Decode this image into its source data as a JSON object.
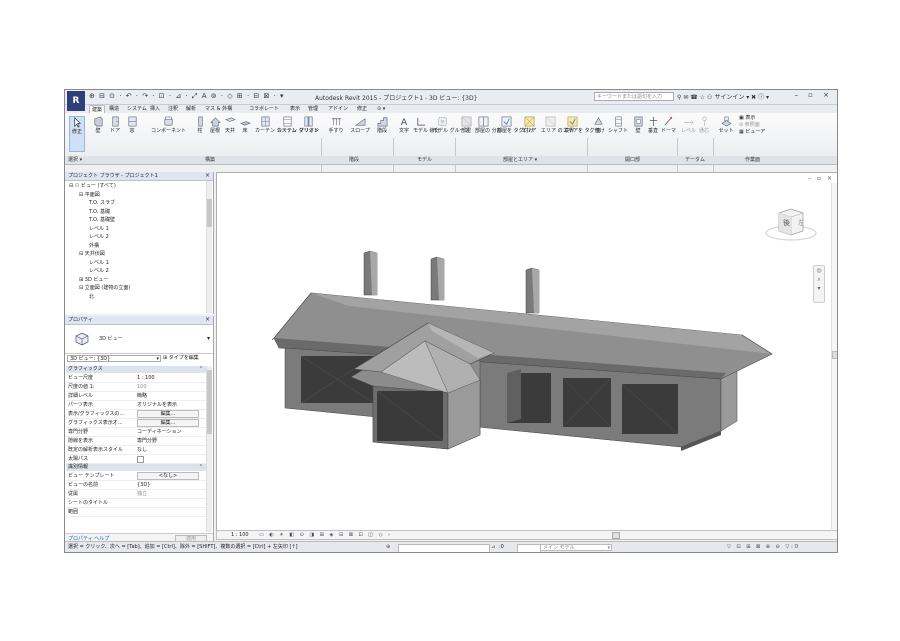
{
  "titlebar": {
    "app_button": "R",
    "quick_access": "⊕ ⊟ ⊙ · ↶ · ↷ · ⊡ · ⊿ · ⤢ A ⊚ · ◇ ⊞ · ⊟ ⊠ · ▾",
    "title": "Autodesk Revit 2015 -    プロジェクト1 - 3D ビュー: {3D}",
    "search_placeholder": "キーワードまたは語句を入力",
    "sign_in": "サインイン",
    "window_controls": "– ▫ ×"
  },
  "tabs": [
    "建築",
    "構造",
    "システム",
    "挿入",
    "注釈",
    "解析",
    "マス & 外構",
    "コラボレート",
    "表示",
    "管理",
    "アドイン",
    "修正",
    "⊙ ▾"
  ],
  "active_tab": "建築",
  "ribbon": {
    "buttons": [
      {
        "label": "修正"
      },
      {
        "label": "壁"
      },
      {
        "label": "ドア"
      },
      {
        "label": "窓"
      },
      {
        "label": "コンポーネント"
      },
      {
        "label": "柱"
      },
      {
        "label": "屋根"
      },
      {
        "label": "天井"
      },
      {
        "label": "床"
      },
      {
        "label": "カーテン システム"
      },
      {
        "label": "カーテン グリッド"
      },
      {
        "label": "マリオン"
      },
      {
        "label": "手すり"
      },
      {
        "label": "スロープ"
      },
      {
        "label": "階段"
      },
      {
        "label": "文字"
      },
      {
        "label": "モデル 線分"
      },
      {
        "label": "モデル グループ"
      },
      {
        "label": "部屋"
      },
      {
        "label": "部屋の 分割"
      },
      {
        "label": "部屋を タグ付け"
      },
      {
        "label": "エリア"
      },
      {
        "label": "エリア の 境界"
      },
      {
        "label": "エリアを タグ付け"
      },
      {
        "label": "面"
      },
      {
        "label": "シャフト"
      },
      {
        "label": "壁"
      },
      {
        "label": "垂直"
      },
      {
        "label": "ドーマ"
      },
      {
        "label": "レベル"
      },
      {
        "label": "通芯"
      },
      {
        "label": "セット"
      },
      {
        "label": "表示"
      },
      {
        "label": "参照面"
      },
      {
        "label": "ビューア"
      }
    ],
    "panels": [
      "選択 ▾",
      "構築",
      "階段",
      "モデル",
      "部屋とエリア ▾",
      "開口部",
      "データム",
      "作業面"
    ]
  },
  "browser": {
    "title": "プロジェクト ブラウザ - プロジェクト1",
    "items": [
      {
        "label": "ビュー (すべて)",
        "prefix": "⊟"
      },
      {
        "label": "平面図",
        "prefix": "⊟"
      },
      {
        "label": "T.O. スラブ",
        "prefix": ""
      },
      {
        "label": "T.O. 基礎",
        "prefix": ""
      },
      {
        "label": "T.O. 基礎壁",
        "prefix": ""
      },
      {
        "label": "レベル 1",
        "prefix": ""
      },
      {
        "label": "レベル 2",
        "prefix": ""
      },
      {
        "label": "外構",
        "prefix": ""
      },
      {
        "label": "天井伏図",
        "prefix": "⊟"
      },
      {
        "label": "レベル 1",
        "prefix": ""
      },
      {
        "label": "レベル 2",
        "prefix": ""
      },
      {
        "label": "3D ビュー",
        "prefix": "⊞"
      },
      {
        "label": "立面図 (建物の立面)",
        "prefix": "⊟"
      },
      {
        "label": "北",
        "prefix": ""
      }
    ]
  },
  "properties": {
    "title": "プロパティ",
    "type_name": "3D ビュー",
    "type_selector": "3D ビュー: {3D}",
    "edit_type": "タイプを編集",
    "section_graphics": "グラフィックス",
    "section_identity": "識別情報",
    "rows": [
      {
        "k": "ビュー尺度",
        "v": "1 : 100"
      },
      {
        "k": "尺度の値   1:",
        "v": "100"
      },
      {
        "k": "詳細レベル",
        "v": "簡略"
      },
      {
        "k": "パーツ表示",
        "v": "オリジナルを表示"
      },
      {
        "k": "表示/グラフィックスの...",
        "v": "編集..."
      },
      {
        "k": "グラフィックス表示オ...",
        "v": "編集..."
      },
      {
        "k": "専門分野",
        "v": "コーディネーション"
      },
      {
        "k": "隠線を表示",
        "v": "専門分野"
      },
      {
        "k": "既定の解析表示スタイル",
        "v": "なし"
      },
      {
        "k": "太陽パス",
        "v": ""
      }
    ],
    "identity_rows": [
      {
        "k": "ビュー テンプレート",
        "v": "<なし>"
      },
      {
        "k": "ビューの名前",
        "v": "{3D}"
      },
      {
        "k": "従属",
        "v": "独立"
      },
      {
        "k": "シートのタイトル",
        "v": ""
      },
      {
        "k": "範囲",
        "v": ""
      }
    ],
    "help": "プロパティ ヘルプ",
    "apply": "適用"
  },
  "viewcube": {
    "face_label": "後",
    "side_label": "左"
  },
  "view_control": {
    "scale": "1 : 100"
  },
  "status": {
    "message": "選択 = クリック、次へ = [Tab]、追加 = [Ctrl]、除外 = [SHIFT]、複数の選択 = [Ctrl] + 左矢印 [↑]",
    "workset_value": ":0",
    "model": "メイン モデル"
  }
}
